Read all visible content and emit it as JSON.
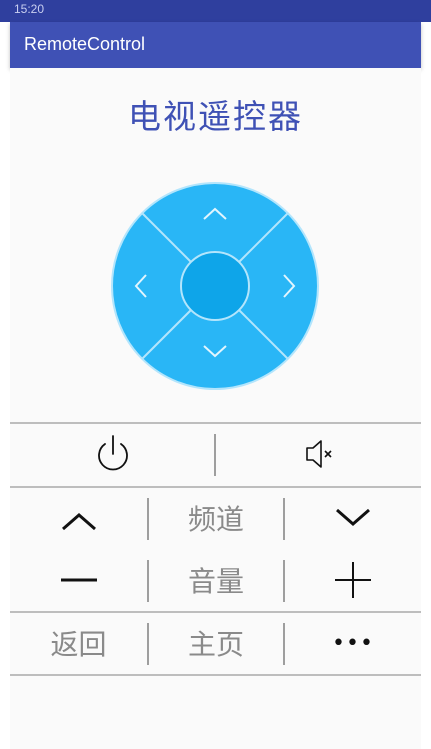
{
  "status_bar": {
    "time": "15:20"
  },
  "app_bar": {
    "title": "RemoteControl"
  },
  "page": {
    "title": "电视遥控器"
  },
  "dpad": {
    "up": "up",
    "down": "down",
    "left": "left",
    "right": "right",
    "center": "ok",
    "colors": {
      "outer": "#29b6f6",
      "center": "#0ea5e9",
      "lines": "#b3e5fc"
    }
  },
  "controls": {
    "row1": {
      "power": "power-icon",
      "mute": "mute-icon"
    },
    "channel": {
      "label": "频道",
      "up": "chevron-up-icon",
      "down": "chevron-down-icon"
    },
    "volume": {
      "label": "音量",
      "minus": "minus-icon",
      "plus": "plus-icon"
    },
    "bottom": {
      "back": "返回",
      "home": "主页",
      "more": "•••"
    }
  },
  "colors": {
    "appbar": "#3f51b5",
    "title": "#3f51b5",
    "label": "#8a8a8a",
    "icon": "#111111",
    "divider": "#bdbdbd"
  }
}
